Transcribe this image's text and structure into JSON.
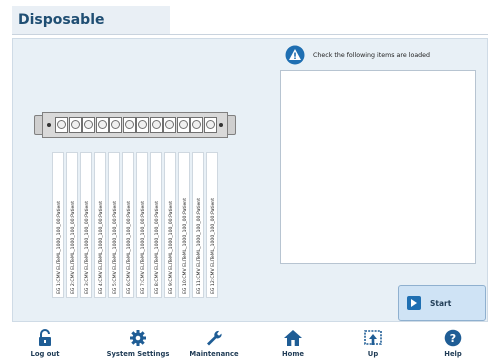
{
  "header": {
    "title": "Disposable"
  },
  "instruction": "Check the following items are loaded",
  "colors": {
    "accent": "#1f4e73",
    "panel": "#e8f0f6",
    "button": "#cfe3f5"
  },
  "rack_slots": 12,
  "labels": [
    "EG 1:CMV ELITeML_1000_100_00:Patient",
    "EG 2:CMV ELITeML_1000_100_00:Patient",
    "EG 3:CMV ELITeML_1000_100_00:Patient",
    "EG 4:CMV ELITeML_1000_100_00:Patient",
    "EG 5:CMV ELITeML_1000_100_00:Patient",
    "EG 6:CMV ELITeML_1000_100_00:Patient",
    "EG 7:CMV ELITeML_1000_100_00:Patient",
    "EG 8:CMV ELITeML_1000_100_00:Patient",
    "EG 9:CMV ELITeML_1000_100_00:Patient",
    "EG 10:CMV ELITeML_1000_100_00:Patient",
    "EG 11:CMV ELITeML_1000_100_00:Patient",
    "EG 12:CMV ELITeML_1000_100_00:Patient"
  ],
  "start": {
    "label": "Start",
    "icon": "arrow-right-icon"
  },
  "footer": [
    {
      "label": "Log out",
      "icon": "unlock-icon"
    },
    {
      "label": "System Settings",
      "icon": "gear-icon"
    },
    {
      "label": "Maintenance",
      "icon": "wrench-icon"
    },
    {
      "label": "Home",
      "icon": "home-icon"
    },
    {
      "label": "Up",
      "icon": "up-icon"
    },
    {
      "label": "Help",
      "icon": "help-icon"
    }
  ]
}
